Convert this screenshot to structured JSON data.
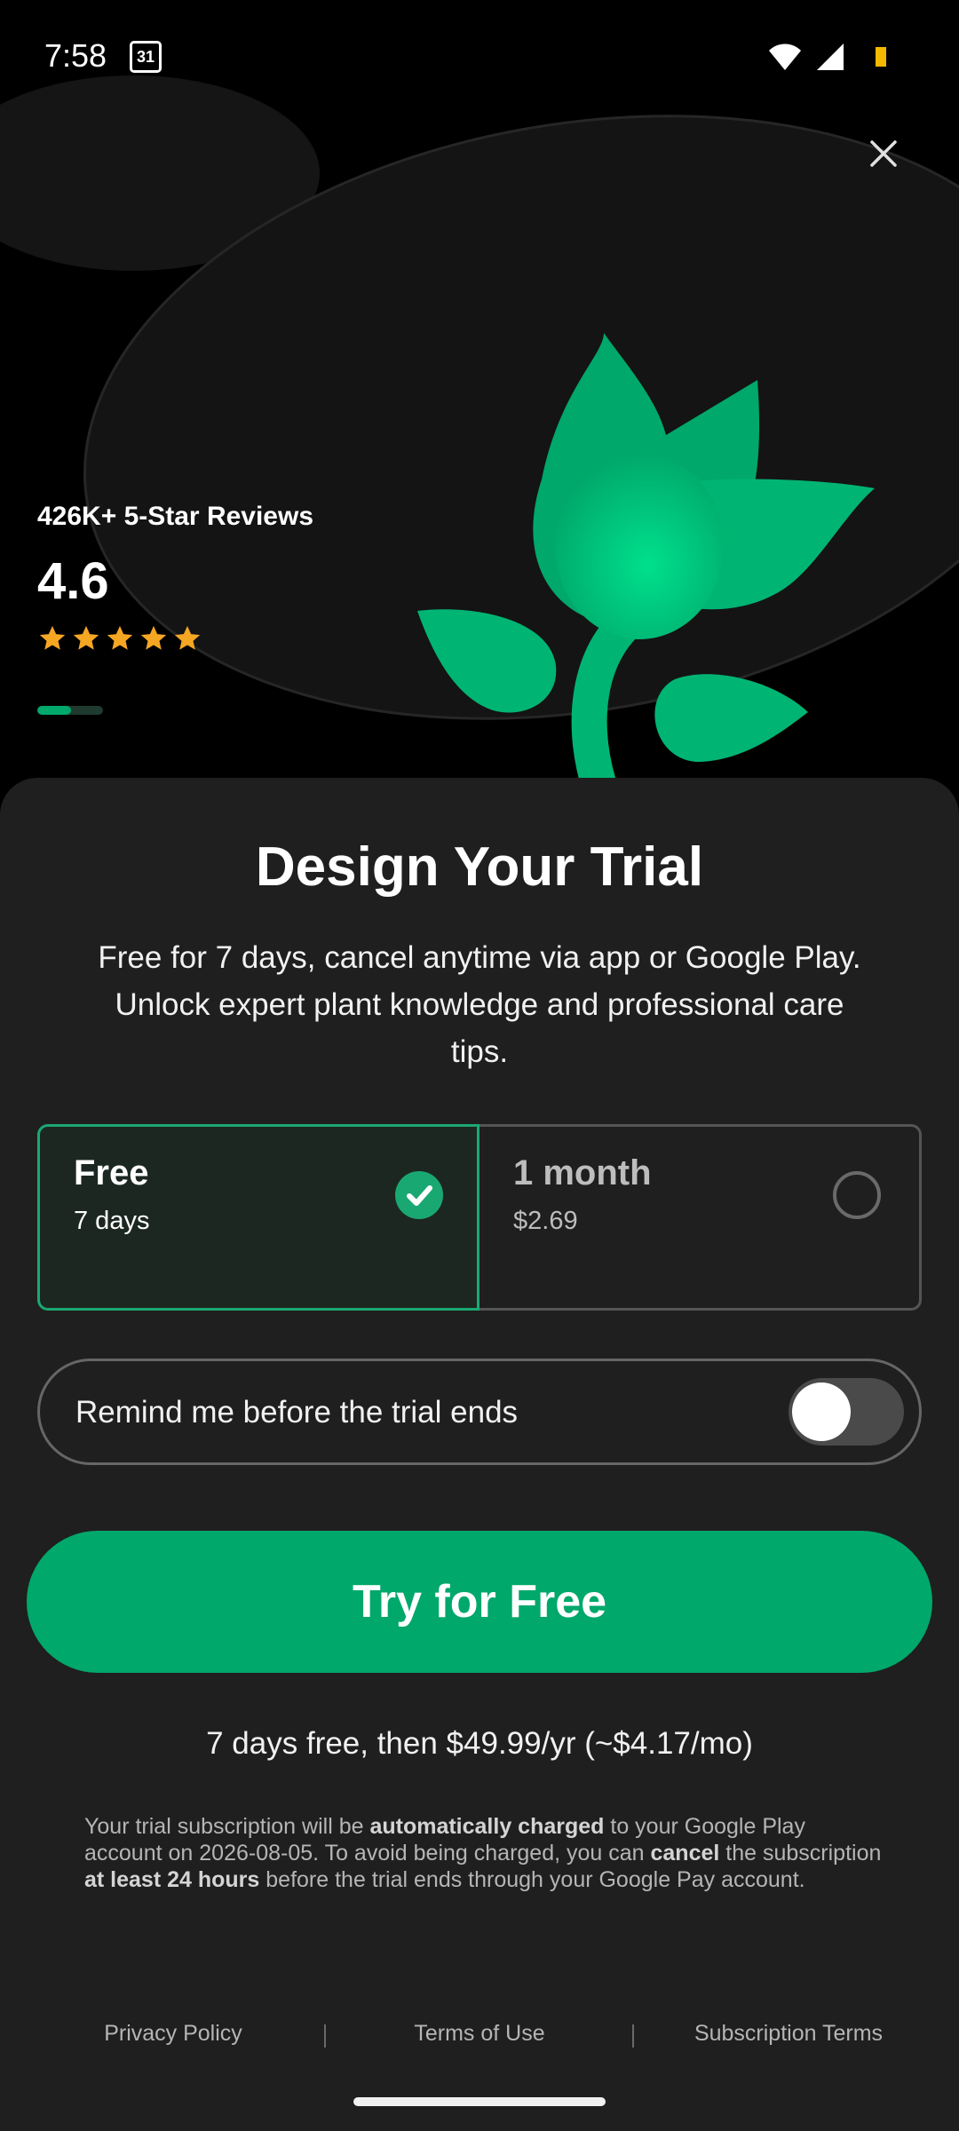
{
  "status_bar": {
    "time": "7:58",
    "calendar_day": "31"
  },
  "hero": {
    "reviews_label": "426K+ 5-Star Reviews",
    "rating": "4.6",
    "stars": 5,
    "star_color": "#f5a623",
    "pager_index": 1,
    "pager_count": 2
  },
  "sheet": {
    "title": "Design Your Trial",
    "description": "Free for 7 days, cancel anytime via app or Google Play. Unlock expert plant knowledge and professional care tips."
  },
  "plans": [
    {
      "name": "Free",
      "detail": "7 days",
      "selected": true
    },
    {
      "name": "1 month",
      "detail": "$2.69",
      "selected": false
    }
  ],
  "reminder": {
    "label": "Remind me before the trial ends",
    "enabled": false
  },
  "cta": {
    "label": "Try for Free"
  },
  "price_line": "7 days free, then $49.99/yr (~$4.17/mo)",
  "legal": {
    "t1": "Your trial subscription will be ",
    "b1": "automatically charged",
    "t2": " to your Google Play account on 2026-08-05. To avoid being charged, you can ",
    "b2": "cancel",
    "t3": " the subscription ",
    "b3": "at least 24 hours",
    "t4": " before the trial ends through your Google Pay account."
  },
  "footer": {
    "privacy": "Privacy Policy",
    "terms": "Terms of Use",
    "subscription": "Subscription Terms"
  },
  "colors": {
    "accent": "#00a86b",
    "sheet_bg": "#1f1f1f",
    "battery": "#f5b800"
  },
  "icons": [
    "calendar-icon",
    "wifi-icon",
    "signal-icon",
    "battery-icon",
    "close-icon",
    "star-icon",
    "check-icon",
    "plant-illustration"
  ]
}
